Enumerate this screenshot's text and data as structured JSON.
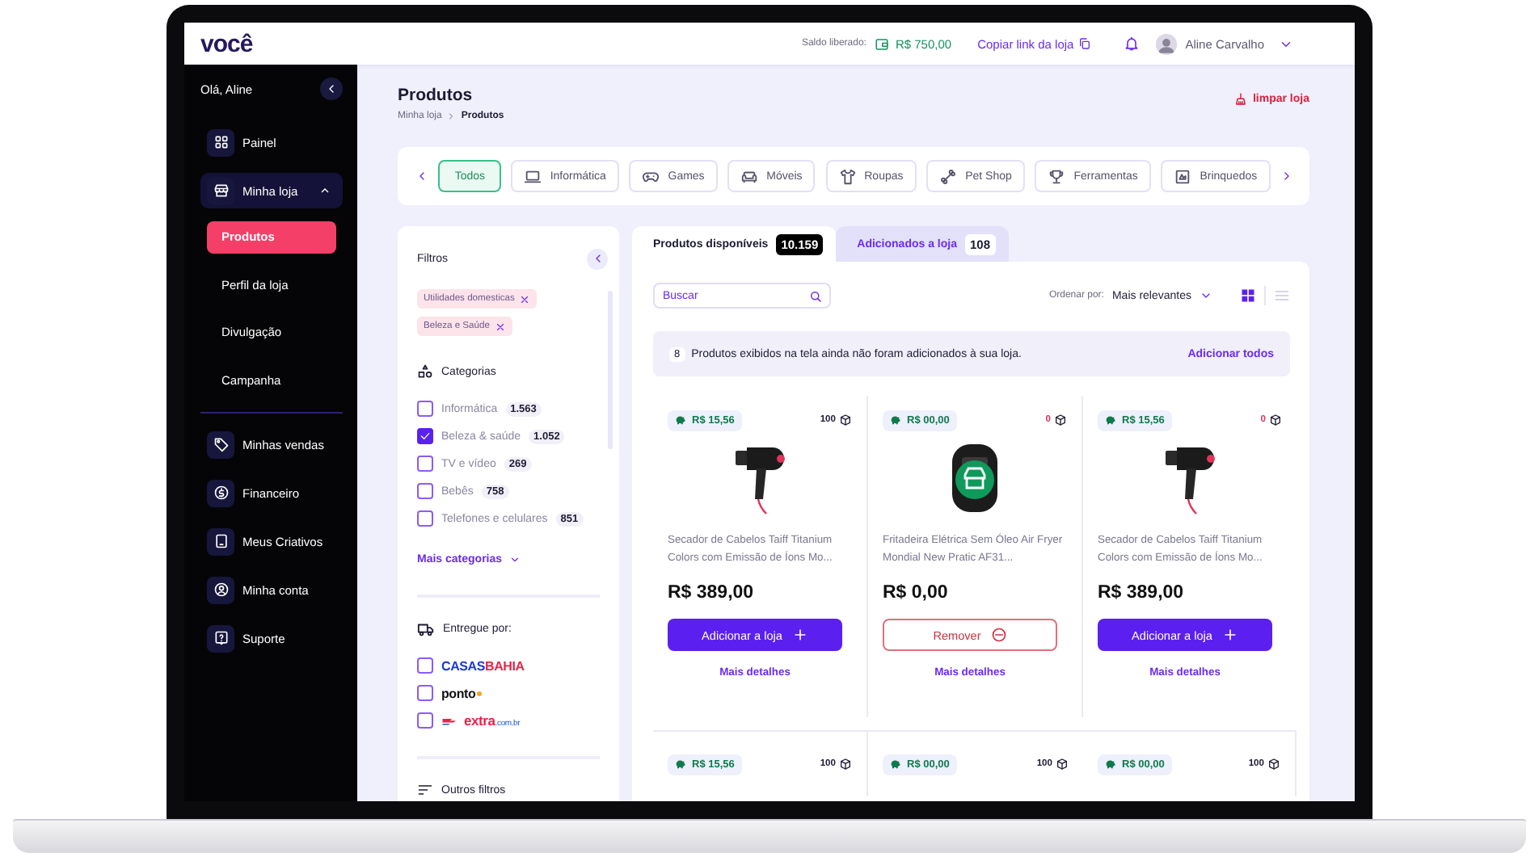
{
  "top_bar": {
    "logo": "você",
    "balance_label": "Saldo liberado:",
    "balance": "R$ 750,00",
    "copy_link": "Copiar link da loja",
    "user_name": "Aline Carvalho"
  },
  "sidebar": {
    "greeting": "Olá, Aline",
    "groups": [
      {
        "items": [
          {
            "label": "Painel",
            "selected": false
          },
          {
            "label": "Minha loja",
            "selected": true,
            "expanded": true,
            "children": [
              {
                "label": "Produtos",
                "selected": true
              },
              {
                "label": "Perfil da loja",
                "selected": false
              },
              {
                "label": "Divulgação",
                "selected": false
              },
              {
                "label": "Campanha",
                "selected": false
              }
            ]
          }
        ]
      },
      {
        "items": [
          {
            "label": "Minhas vendas",
            "selected": false
          },
          {
            "label": "Financeiro",
            "selected": false
          },
          {
            "label": "Meus Criativos",
            "selected": false
          },
          {
            "label": "Minha conta",
            "selected": false
          },
          {
            "label": "Suporte",
            "selected": false
          }
        ]
      }
    ]
  },
  "page": {
    "title": "Produtos",
    "breadcrumb": [
      "Minha loja",
      "Produtos"
    ],
    "clear_store": "limpar loja"
  },
  "categories": [
    {
      "label": "Todos",
      "selected": true
    },
    {
      "label": "Informática",
      "selected": false
    },
    {
      "label": "Games",
      "selected": false
    },
    {
      "label": "Móveis",
      "selected": false
    },
    {
      "label": "Roupas",
      "selected": false
    },
    {
      "label": "Pet Shop",
      "selected": false
    },
    {
      "label": "Ferramentas",
      "selected": false
    },
    {
      "label": "Brinquedos",
      "selected": false
    }
  ],
  "filters": {
    "title": "Filtros",
    "active_filters": [
      "Utilidades domesticas",
      "Beleza e Saúde"
    ],
    "categories_title": "Categorias",
    "categories": [
      {
        "label": "Informática",
        "count": "1.563",
        "checked": false
      },
      {
        "label": "Beleza & saúde",
        "count": "1.052",
        "checked": true
      },
      {
        "label": "TV e vídeo",
        "count": "269",
        "checked": false
      },
      {
        "label": "Bebês",
        "count": "758",
        "checked": false
      },
      {
        "label": "Telefones e celulares",
        "count": "851",
        "checked": false
      }
    ],
    "more": "Mais categorias",
    "delivery_title": "Entregue por:",
    "sellers": [
      {
        "kind": "casasbahia",
        "logo": "CASAS",
        "logo_suffix": "BAHIA",
        "checked": false
      },
      {
        "kind": "ponto",
        "logo": "ponto",
        "checked": false
      },
      {
        "kind": "extra",
        "logo": "extra",
        "logo_suffix": ".com.br",
        "checked": false
      }
    ],
    "other_title": "Outros filtros"
  },
  "products_panel": {
    "tabs": [
      {
        "label": "Produtos disponíveis",
        "count": "10.159",
        "selected": true
      },
      {
        "label": "Adicionados a loja",
        "count": "108",
        "selected": false
      }
    ],
    "search": {
      "placeholder": "Buscar"
    },
    "sort_label": "Ordenar por:",
    "sort_value": "Mais relevantes",
    "views": [
      {
        "kind": "grid",
        "selected": true
      },
      {
        "kind": "list",
        "selected": false
      }
    ],
    "notice": {
      "count": "8",
      "text": "Produtos exibidos na tela ainda não foram adicionados à sua loja.",
      "action": "Adicionar todos"
    }
  },
  "products": [
    {
      "kind": "hair-dryer",
      "commission": "R$ 15,56",
      "stock": "100",
      "stock_alert": false,
      "title": "Secador de Cabelos Taiff Titanium Colors com Emissão de Íons Mo...",
      "price": "R$ 389,00",
      "added": false,
      "button": "Adicionar a loja",
      "details": "Mais detalhes"
    },
    {
      "kind": "air-fryer",
      "commission": "R$ 00,00",
      "stock": "0",
      "stock_alert": true,
      "title": "Fritadeira Elétrica Sem Óleo Air Fryer Mondial New Pratic AF31...",
      "price": "R$ 0,00",
      "added": true,
      "button": "Remover",
      "details": "Mais detalhes"
    },
    {
      "kind": "hair-dryer",
      "commission": "R$ 15,56",
      "stock": "0",
      "stock_alert": true,
      "title": "Secador de Cabelos Taiff Titanium Colors com Emissão de Íons Mo...",
      "price": "R$ 389,00",
      "added": false,
      "button": "Adicionar a loja",
      "details": "Mais detalhes"
    },
    {
      "commission": "R$ 15,56",
      "stock": "100",
      "stock_alert": false
    },
    {
      "commission": "R$ 00,00",
      "stock": "100",
      "stock_alert": false
    },
    {
      "commission": "R$ 00,00",
      "stock": "100",
      "stock_alert": false
    }
  ]
}
